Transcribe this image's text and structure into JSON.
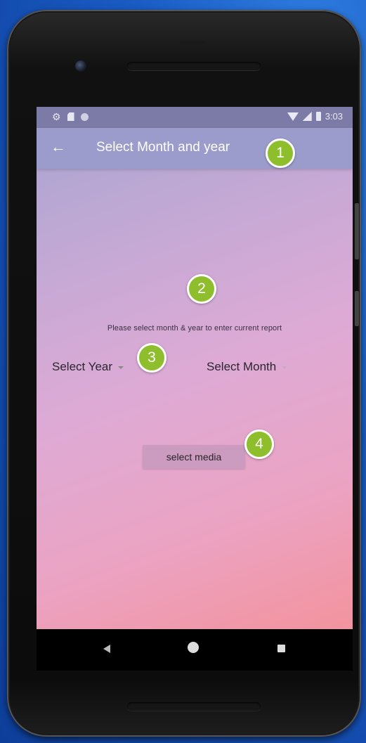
{
  "status_bar": {
    "time": "3:03",
    "icons": [
      "gear-icon",
      "sd-card-icon",
      "circle-icon",
      "wifi-icon",
      "signal-icon",
      "battery-icon"
    ]
  },
  "app_bar": {
    "back_icon": "arrow-left-icon",
    "back_glyph": "←",
    "title": "Select Month and year"
  },
  "main": {
    "instruction": "Please select month & year to enter current report",
    "year_dropdown": {
      "selected": "Select Year"
    },
    "month_dropdown": {
      "selected": "Select Month"
    },
    "select_media_label": "select media"
  },
  "nav_bar": {
    "icons": [
      "nav-back-icon",
      "nav-home-icon",
      "nav-recents-icon"
    ]
  },
  "markers": [
    "1",
    "2",
    "3",
    "4"
  ],
  "colors": {
    "app_bar": "#9b9ccb",
    "status_bar": "#7c7aa6",
    "gradient_start": "#a9a5d0",
    "gradient_end": "#f3939e",
    "button": "#cb9cc0",
    "marker": "#8fbe2d",
    "desktop_background": "#1a5cc4"
  }
}
